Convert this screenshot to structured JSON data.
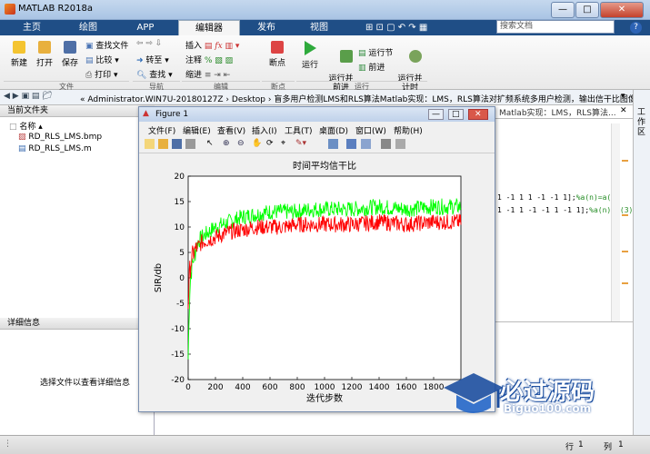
{
  "window": {
    "title": "MATLAB R2018a",
    "controls": [
      "—",
      "□",
      "✕"
    ]
  },
  "ribbon": {
    "tabs": [
      "主页",
      "绘图",
      "APP",
      "编辑器",
      "发布",
      "视图"
    ],
    "search_placeholder": "搜索文档",
    "file": {
      "new": "新建",
      "open": "打开",
      "save": "保存",
      "find_files": "查找文件",
      "compare": "比较",
      "print": "打印",
      "section": "文件"
    },
    "nav": {
      "goto": "转至",
      "find": "查找",
      "section": "导航"
    },
    "edit": {
      "insert": "插入",
      "comment": "注释",
      "indent": "缩进",
      "section": "编辑"
    },
    "breakpoints": {
      "label": "断点",
      "section": "断点"
    },
    "run": {
      "run": "运行",
      "run_advance": "运行并\n前进",
      "run_section": "运行节",
      "advance": "前进",
      "run_time": "运行并\n计时",
      "section": "运行"
    }
  },
  "address": {
    "path": "« Administrator.WIN7U-20180127Z  ›  Desktop  ›  盲多用户检测LMS和RLS算法Matlab实现：LMS，RLS算法对扩频系统多用户检测，输出信干比图像"
  },
  "current_folder": {
    "header": "当前文件夹",
    "col_name": "名称",
    "files": [
      "RD_RLS_LMS.bmp",
      "RD_RLS_LMS.m"
    ]
  },
  "details": {
    "header": "详细信息",
    "message": "选择文件以查看详细信息"
  },
  "editor": {
    "tab_title": "Matlab实现：LMS，RLS算法...",
    "lines": [
      {
        "code": "1 -1 1 1 -1 -1 1];",
        "comment": "%a(n)=a(2)"
      },
      {
        "code": "1 -1 1 -1 -1 1 -1 1];",
        "comment": "%a(n)=a(3)"
      }
    ]
  },
  "right_sidebar": {
    "label": "工作区"
  },
  "figure": {
    "title": "Figure 1",
    "menu": [
      "文件(F)",
      "编辑(E)",
      "查看(V)",
      "插入(I)",
      "工具(T)",
      "桌面(D)",
      "窗口(W)",
      "帮助(H)"
    ]
  },
  "chart_data": {
    "type": "line",
    "title": "时间平均信干比",
    "xlabel": "迭代步数",
    "ylabel": "SIR/db",
    "xlim": [
      0,
      2000
    ],
    "ylim": [
      -20,
      20
    ],
    "xticks": [
      0,
      200,
      400,
      600,
      800,
      1000,
      1200,
      1400,
      1600,
      1800
    ],
    "yticks": [
      -20,
      -15,
      -10,
      -5,
      0,
      5,
      10,
      15,
      20
    ],
    "series": [
      {
        "color": "#00ff00",
        "x": [
          0,
          10,
          20,
          40,
          70,
          100,
          150,
          200,
          300,
          400,
          500,
          600,
          700,
          800,
          900,
          1000,
          1200,
          1400,
          1600,
          1800,
          2000
        ],
        "y": [
          -16,
          -3,
          1,
          4,
          7,
          8,
          9,
          10,
          11,
          12,
          12.5,
          13,
          13,
          13,
          13.5,
          13.5,
          13.5,
          14,
          13.5,
          14,
          14
        ]
      },
      {
        "color": "#ff0000",
        "x": [
          0,
          10,
          20,
          40,
          70,
          100,
          150,
          200,
          300,
          400,
          500,
          600,
          700,
          800,
          900,
          1000,
          1200,
          1400,
          1600,
          1800,
          2000
        ],
        "y": [
          -5,
          1,
          3,
          5,
          6,
          7,
          7.5,
          8,
          9,
          9.5,
          10,
          10,
          10,
          10.5,
          10.5,
          10.5,
          10.5,
          11,
          10.5,
          11,
          11
        ]
      }
    ]
  },
  "status": {
    "row_label": "行",
    "row": "1",
    "col_label": "列",
    "col": "1"
  },
  "watermark": {
    "text": "必过源码",
    "sub": "Biguo100.com"
  }
}
